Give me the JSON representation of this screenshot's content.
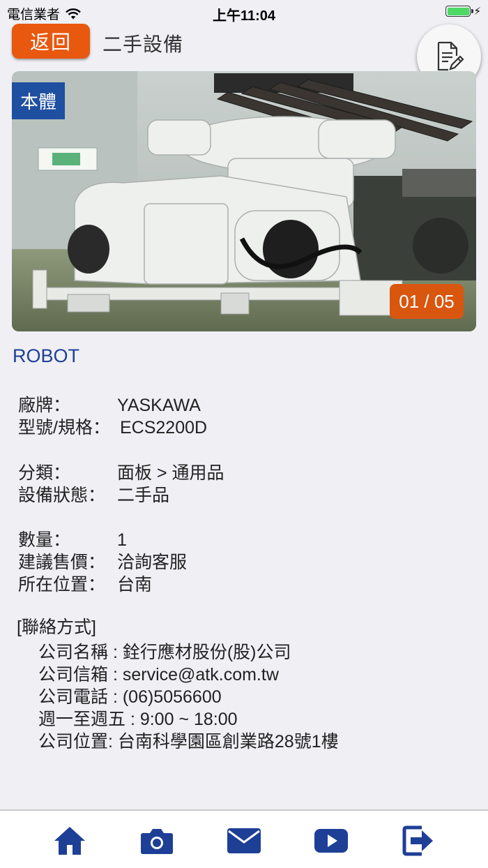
{
  "status_bar": {
    "carrier": "電信業者",
    "time": "上午11:04"
  },
  "header": {
    "back_label": "返回",
    "title": "二手設備"
  },
  "photo": {
    "badge": "本體",
    "counter": "01 / 05"
  },
  "product": {
    "name": "ROBOT"
  },
  "specs": {
    "brand_label": "廠牌：",
    "brand_value": "YASKAWA",
    "model_label": "型號/規格：",
    "model_value": "ECS2200D",
    "category_label": "分類：",
    "category_value": "面板 > 通用品",
    "condition_label": "設備狀態：",
    "condition_value": "二手品",
    "quantity_label": "數量：",
    "quantity_value": "1",
    "price_label": "建議售價：",
    "price_value": "洽詢客服",
    "location_label": "所在位置：",
    "location_value": "台南"
  },
  "contact": {
    "heading": "[聯絡方式]",
    "lines": [
      "公司名稱 : 銓行應材股份(股)公司",
      "公司信箱 : service@atk.com.tw",
      "公司電話 : (06)5056600",
      "週一至週五 : 9:00 ~ 18:00",
      "公司位置: 台南科學園區創業路28號1樓"
    ]
  },
  "nav": {
    "icons": [
      "home-icon",
      "camera-icon",
      "mail-icon",
      "video-icon",
      "logout-icon"
    ]
  },
  "colors": {
    "accent_orange": "#e8580f",
    "brand_blue": "#1e4fa0",
    "nav_icon": "#1e3f96"
  }
}
